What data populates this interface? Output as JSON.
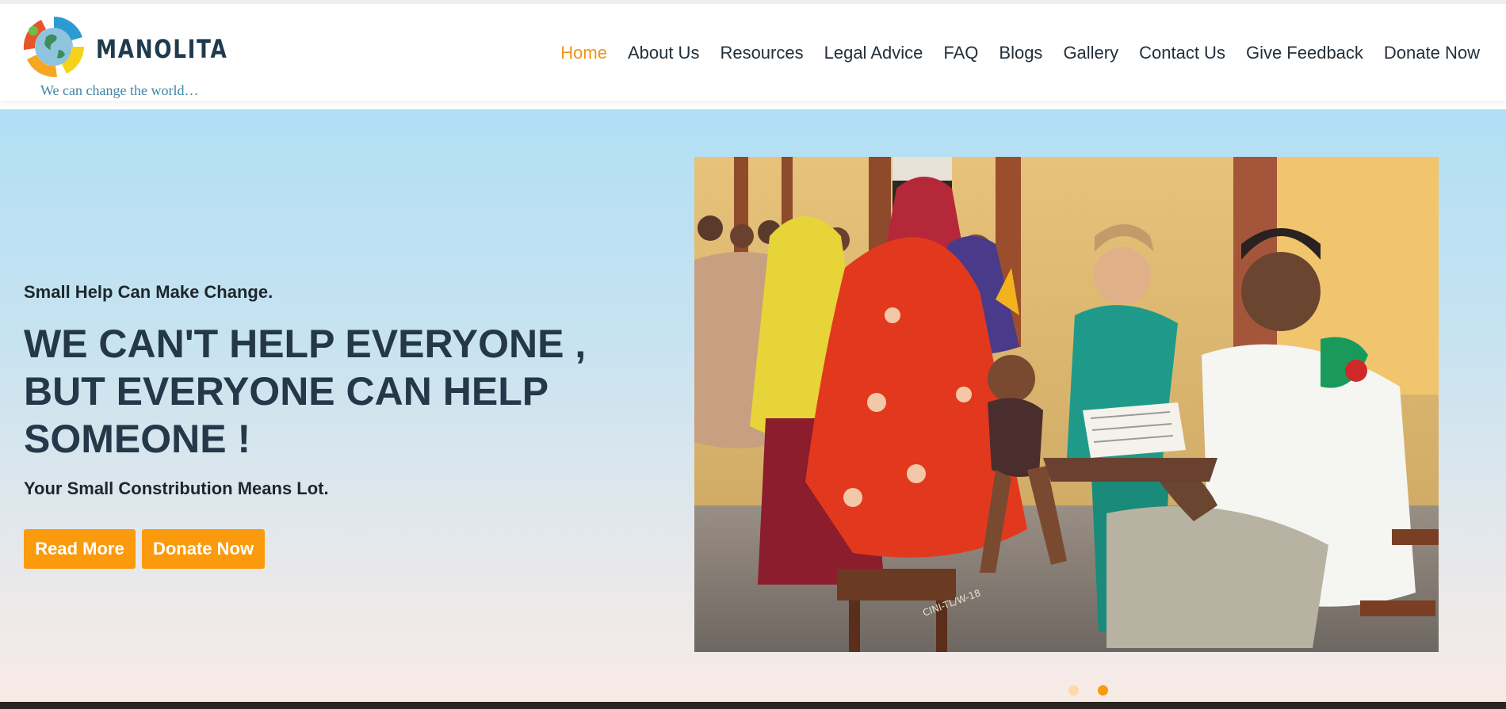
{
  "brand": {
    "name": "MANOLITA",
    "tagline": "We can change the world…",
    "logo_colors": [
      "#2e9ad3",
      "#f5a623",
      "#f6d21b",
      "#e8552a",
      "#6bbf4a"
    ]
  },
  "nav": {
    "items": [
      {
        "label": "Home",
        "active": true
      },
      {
        "label": "About Us"
      },
      {
        "label": "Resources"
      },
      {
        "label": "Legal Advice"
      },
      {
        "label": "FAQ"
      },
      {
        "label": "Blogs"
      },
      {
        "label": "Gallery"
      },
      {
        "label": "Contact Us"
      },
      {
        "label": "Give Feedback"
      },
      {
        "label": "Donate Now"
      }
    ]
  },
  "hero": {
    "subtitle": "Small Help Can Make Change.",
    "headline_lines": [
      "WE CAN'T HELP EVERYONE ,",
      "BUT EVERYONE CAN HELP",
      "SOMEONE !"
    ],
    "tagline": "Your Small Constribution Means Lot.",
    "read_more_label": "Read More",
    "donate_label": "Donate Now",
    "image_alt": "Doctor examining a child held by a mother at a community health camp",
    "slider": {
      "count": 2,
      "active_index": 1
    }
  },
  "colors": {
    "accent": "#fb9a0c",
    "heading": "#24384a",
    "nav_text": "#23303b"
  }
}
